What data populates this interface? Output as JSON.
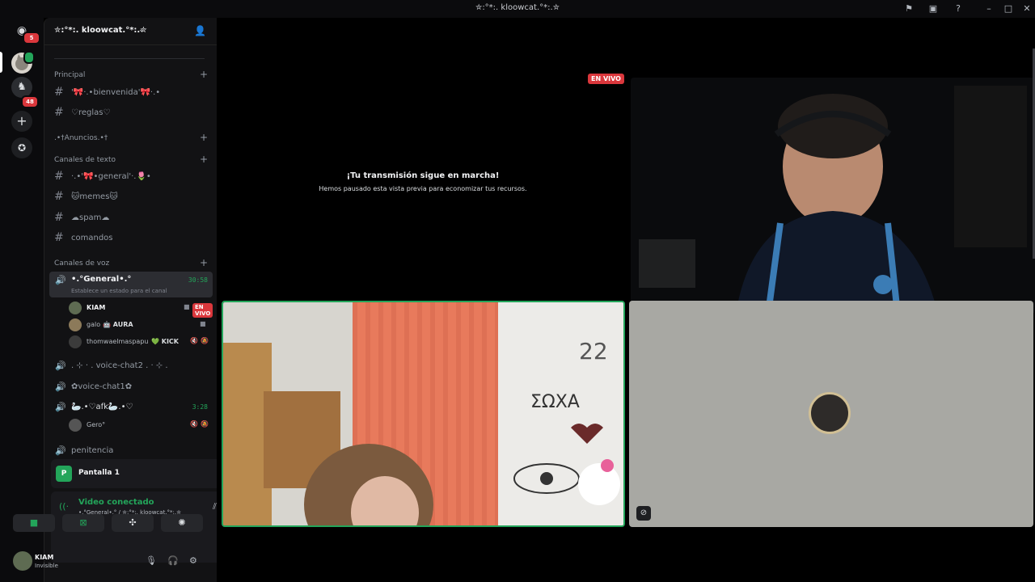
{
  "window": {
    "title": "✮:°*:. kloowcat.°*:.✮"
  },
  "rail": {
    "badges": [
      "5",
      "48"
    ]
  },
  "guild": {
    "name": "✮:°*:. kloowcat.°*:.✮"
  },
  "categories": {
    "principal": "Principal",
    "anuncios": ".•†Anuncios.•†",
    "texto": "Canales de texto",
    "voz": "Canales de voz"
  },
  "channels": {
    "bienvenida": "'🎀·.•bienvenida'🎀·.•",
    "reglas": "♡reglas♡",
    "general": "·.•'🎀•general'·.🌷•",
    "memes": "🐱memes🐱",
    "spam": "☁spam☁",
    "comandos": "comandos"
  },
  "voice": {
    "general": {
      "name": "•.°General•.°",
      "status": "Establece un estado para el canal",
      "timer": "30:58",
      "members": [
        {
          "name": "KIAM",
          "tag": "EN VIVO"
        },
        {
          "name": "galo",
          "tag": "🤖 AURA"
        },
        {
          "name": "thomwaelmaspapu",
          "tag": "💚 KICK"
        }
      ]
    },
    "chat2": ". ⊹ · . voice-chat2 . · ⊹ .",
    "chat1": "✿voice-chat1✿",
    "afk": {
      "name": "🦢.•♡afk🦢.•♡",
      "timer": "3:28",
      "member": "Gero°"
    },
    "penitencia": "penitencia"
  },
  "screen_panel": {
    "label": "Pantalla 1"
  },
  "voice_panel": {
    "status": "Video conectado",
    "channel": "•.°General•.° / ✮:°*:. kloowcat.°*:.✮"
  },
  "user": {
    "name": "KIAM",
    "status": "Invisible"
  },
  "stage": {
    "live_label": "EN VIVO",
    "paused_title": "¡Tu transmisión sigue en marcha!",
    "paused_sub": "Hemos pausado esta vista previa para economizar tus recursos."
  },
  "colors": {
    "accent_green": "#23a55a",
    "live_red": "#da373c",
    "brand": "#5865f2"
  }
}
